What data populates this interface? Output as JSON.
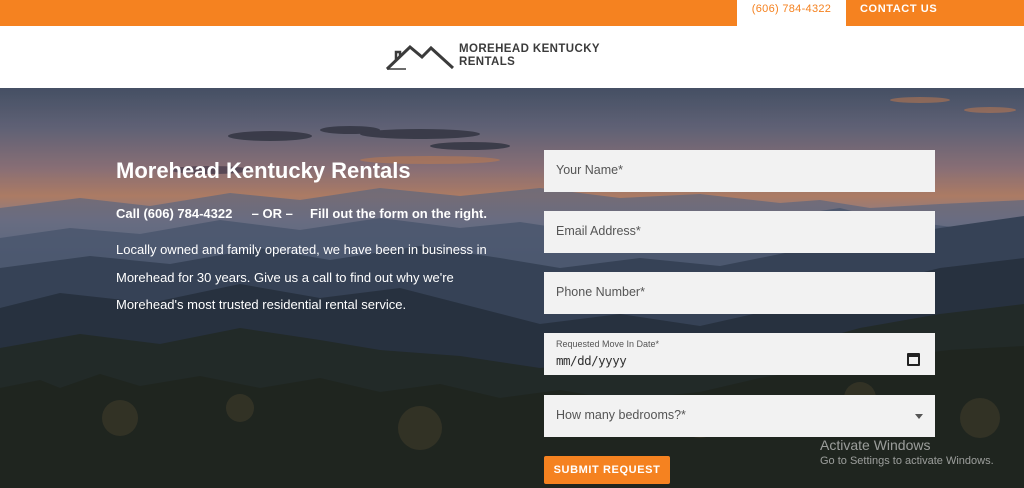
{
  "topbar": {
    "phone": "(606) 784-4322",
    "contact_label": "CONTACT US"
  },
  "logo": {
    "line1": "MOREHEAD KENTUCKY",
    "line2": "RENTALS"
  },
  "hero": {
    "title": "Morehead Kentucky Rentals",
    "call_text": "Call (606) 784-4322",
    "or_text": "– OR –",
    "fill_text": "Fill out the form on the right.",
    "description": "Locally owned and family operated, we have been in business in Morehead for 30 years. Give us a call to find out why we're Morehead's most trusted residential rental service."
  },
  "form": {
    "name_placeholder": "Your Name*",
    "email_placeholder": "Email Address*",
    "phone_placeholder": "Phone Number*",
    "date_label": "Requested Move In Date*",
    "date_value": "mm/dd/yyyy",
    "bedrooms_placeholder": "How many bedrooms?*",
    "submit_label": "SUBMIT REQUEST"
  },
  "watermark": {
    "line1": "Activate Windows",
    "line2": "Go to Settings to activate Windows."
  },
  "colors": {
    "accent": "#f58220",
    "field_bg": "#f2f2f2"
  }
}
